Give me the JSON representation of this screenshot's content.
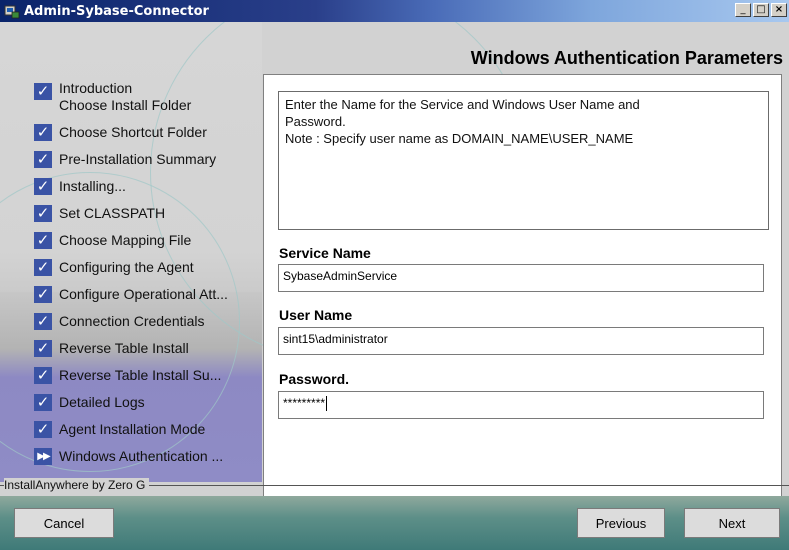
{
  "window": {
    "title": "Admin-Sybase-Connector",
    "minimize": "_",
    "maximize": "□",
    "close": "×"
  },
  "header": {
    "title": "Windows Authentication Parameters"
  },
  "steps": [
    {
      "label": "Introduction",
      "status": "done"
    },
    {
      "label": "Choose Install Folder",
      "status": "done"
    },
    {
      "label": "Choose Shortcut Folder",
      "status": "done"
    },
    {
      "label": "Pre-Installation Summary",
      "status": "done"
    },
    {
      "label": "Installing...",
      "status": "done"
    },
    {
      "label": "Set CLASSPATH",
      "status": "done"
    },
    {
      "label": "Choose Mapping File",
      "status": "done"
    },
    {
      "label": "Configuring the Agent",
      "status": "done"
    },
    {
      "label": "Configure Operational Att...",
      "status": "done"
    },
    {
      "label": "Connection Credentials",
      "status": "done"
    },
    {
      "label": "Reverse Table Install",
      "status": "done"
    },
    {
      "label": "Reverse Table Install Su...",
      "status": "done"
    },
    {
      "label": "Detailed Logs",
      "status": "done"
    },
    {
      "label": "Agent Installation Mode",
      "status": "done"
    },
    {
      "label": "Windows Authentication ...",
      "status": "current"
    }
  ],
  "icons": {
    "done": "✓",
    "current": "▶▶"
  },
  "description": {
    "line1": "Enter the Name for the Service and Windows User Name and",
    "line2": "Password.",
    "line3": "Note : Specify user name as  DOMAIN_NAME\\USER_NAME"
  },
  "form": {
    "service_label": "Service Name",
    "service_value": "SybaseAdminService",
    "user_label": "User Name",
    "user_value": "sint15\\administrator",
    "password_label": "Password.",
    "password_value": "*********"
  },
  "footer": {
    "brand": "InstallAnywhere by Zero G",
    "cancel": "Cancel",
    "previous": "Previous",
    "next": "Next"
  }
}
